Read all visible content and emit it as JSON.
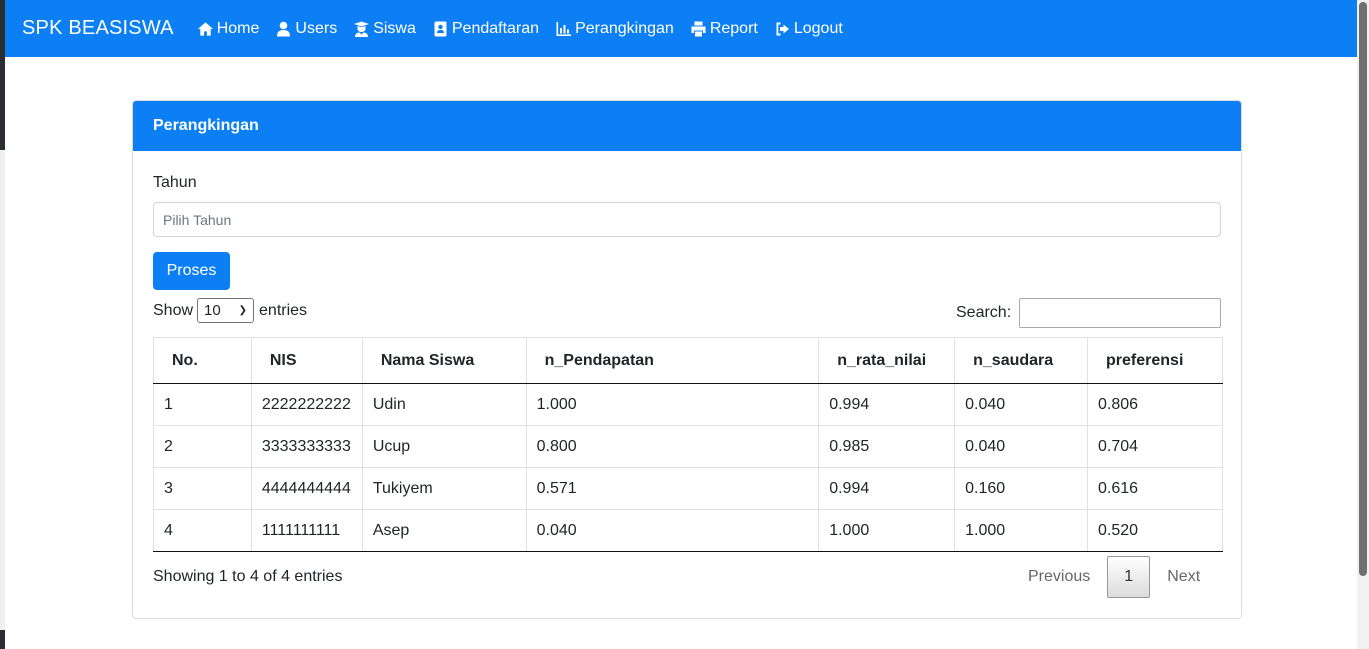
{
  "nav": {
    "brand": "SPK BEASISWA",
    "items": [
      {
        "label": "Home",
        "icon": "home-icon"
      },
      {
        "label": "Users",
        "icon": "user-icon"
      },
      {
        "label": "Siswa",
        "icon": "student-icon"
      },
      {
        "label": "Pendaftaran",
        "icon": "address-book-icon"
      },
      {
        "label": "Perangkingan",
        "icon": "bar-chart-icon"
      },
      {
        "label": "Report",
        "icon": "print-icon"
      },
      {
        "label": "Logout",
        "icon": "logout-icon"
      }
    ]
  },
  "card": {
    "title": "Perangkingan",
    "tahun_label": "Tahun",
    "tahun_placeholder": "Pilih Tahun",
    "proses_label": "Proses"
  },
  "datatable": {
    "show_label": "Show",
    "entries_label": "entries",
    "page_length": "10",
    "search_label": "Search:",
    "columns": [
      "No.",
      "NIS",
      "Nama Siswa",
      "n_Pendapatan",
      "n_rata_nilai",
      "n_saudara",
      "preferensi"
    ],
    "rows": [
      [
        "1",
        "2222222222",
        "Udin",
        "1.000",
        "0.994",
        "0.040",
        "0.806"
      ],
      [
        "2",
        "3333333333",
        "Ucup",
        "0.800",
        "0.985",
        "0.040",
        "0.704"
      ],
      [
        "3",
        "4444444444",
        "Tukiyem",
        "0.571",
        "0.994",
        "0.160",
        "0.616"
      ],
      [
        "4",
        "1111111111",
        "Asep",
        "0.040",
        "1.000",
        "1.000",
        "0.520"
      ]
    ],
    "info": "Showing 1 to 4 of 4 entries",
    "previous_label": "Previous",
    "current_page": "1",
    "next_label": "Next"
  },
  "colors": {
    "primary": "#0d7ff5"
  }
}
